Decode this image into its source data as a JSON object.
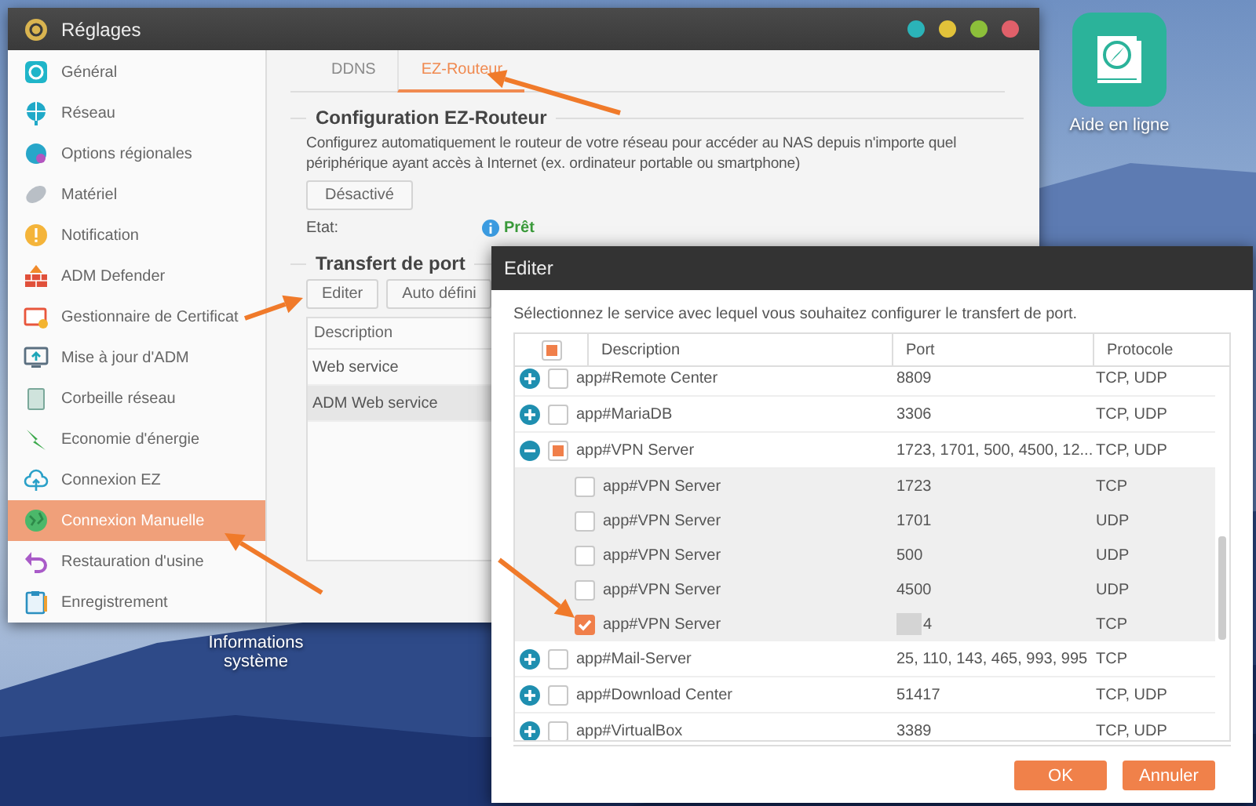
{
  "desktop": {
    "icons": [
      {
        "label": "Aide en ligne"
      },
      {
        "label": "Informations système"
      }
    ]
  },
  "window": {
    "title": "Réglages",
    "sidebar": {
      "items": [
        {
          "label": "Général",
          "selected": false
        },
        {
          "label": "Réseau",
          "selected": false
        },
        {
          "label": "Options régionales",
          "selected": false
        },
        {
          "label": "Matériel",
          "selected": false
        },
        {
          "label": "Notification",
          "selected": false
        },
        {
          "label": "ADM Defender",
          "selected": false
        },
        {
          "label": "Gestionnaire de Certificat",
          "selected": false
        },
        {
          "label": "Mise à jour d'ADM",
          "selected": false
        },
        {
          "label": "Corbeille réseau",
          "selected": false
        },
        {
          "label": "Economie d'énergie",
          "selected": false
        },
        {
          "label": "Connexion EZ",
          "selected": false
        },
        {
          "label": "Connexion Manuelle",
          "selected": true
        },
        {
          "label": "Restauration d'usine",
          "selected": false
        },
        {
          "label": "Enregistrement",
          "selected": false
        }
      ]
    },
    "tabs": [
      {
        "label": "DDNS",
        "selected": false
      },
      {
        "label": "EZ-Routeur",
        "selected": true
      }
    ],
    "ez_router": {
      "heading": "Configuration EZ-Routeur",
      "description": "Configurez automatiquement le routeur de votre réseau pour accéder au NAS depuis n'importe quel périphérique ayant accès à Internet (ex. ordinateur portable ou smartphone)",
      "toggle_button": "Désactivé",
      "status_label": "Etat:",
      "status_value": "Prêt"
    },
    "port_forwarding": {
      "heading": "Transfert de port",
      "buttons": [
        "Editer",
        "Auto défini"
      ],
      "table": {
        "columns": [
          "Description"
        ],
        "rows": [
          {
            "description": "Web service",
            "selected": false
          },
          {
            "description": "ADM Web service",
            "selected": true
          }
        ]
      }
    }
  },
  "dialog": {
    "title": "Editer",
    "instruction": "Sélectionnez le service avec lequel vous souhaitez configurer le transfert de port.",
    "table": {
      "select_all": {
        "checked": false,
        "indeterminate": true
      },
      "columns": [
        "Description",
        "Port",
        "Protocole"
      ],
      "rows": [
        {
          "description": "app#Remote Center",
          "port": "8809",
          "protocol": "TCP, UDP",
          "checked": false,
          "indeterminate": false,
          "expanded": false
        },
        {
          "description": "app#MariaDB",
          "port": "3306",
          "protocol": "TCP, UDP",
          "checked": false,
          "indeterminate": false,
          "expanded": false
        },
        {
          "description": "app#VPN Server",
          "port": "1723, 1701, 500, 4500, 12...",
          "protocol": "TCP, UDP",
          "checked": false,
          "indeterminate": true,
          "expanded": true,
          "children": [
            {
              "description": "app#VPN Server",
              "port": "1723",
              "protocol": "TCP",
              "checked": false,
              "redacted": false
            },
            {
              "description": "app#VPN Server",
              "port": "1701",
              "protocol": "UDP",
              "checked": false,
              "redacted": false
            },
            {
              "description": "app#VPN Server",
              "port": "500",
              "protocol": "UDP",
              "checked": false,
              "redacted": false
            },
            {
              "description": "app#VPN Server",
              "port": "4500",
              "protocol": "UDP",
              "checked": false,
              "redacted": false
            },
            {
              "description": "app#VPN Server",
              "port": "4",
              "protocol": "TCP",
              "checked": true,
              "redacted": true
            }
          ]
        },
        {
          "description": "app#Mail-Server",
          "port": "25, 110, 143, 465, 993, 995",
          "protocol": "TCP",
          "checked": false,
          "indeterminate": false,
          "expanded": false
        },
        {
          "description": "app#Download Center",
          "port": "51417",
          "protocol": "TCP, UDP",
          "checked": false,
          "indeterminate": false,
          "expanded": false
        },
        {
          "description": "app#VirtualBox",
          "port": "3389",
          "protocol": "TCP, UDP",
          "checked": false,
          "indeterminate": false,
          "expanded": false
        }
      ]
    },
    "buttons": [
      "OK",
      "Annuler"
    ]
  }
}
